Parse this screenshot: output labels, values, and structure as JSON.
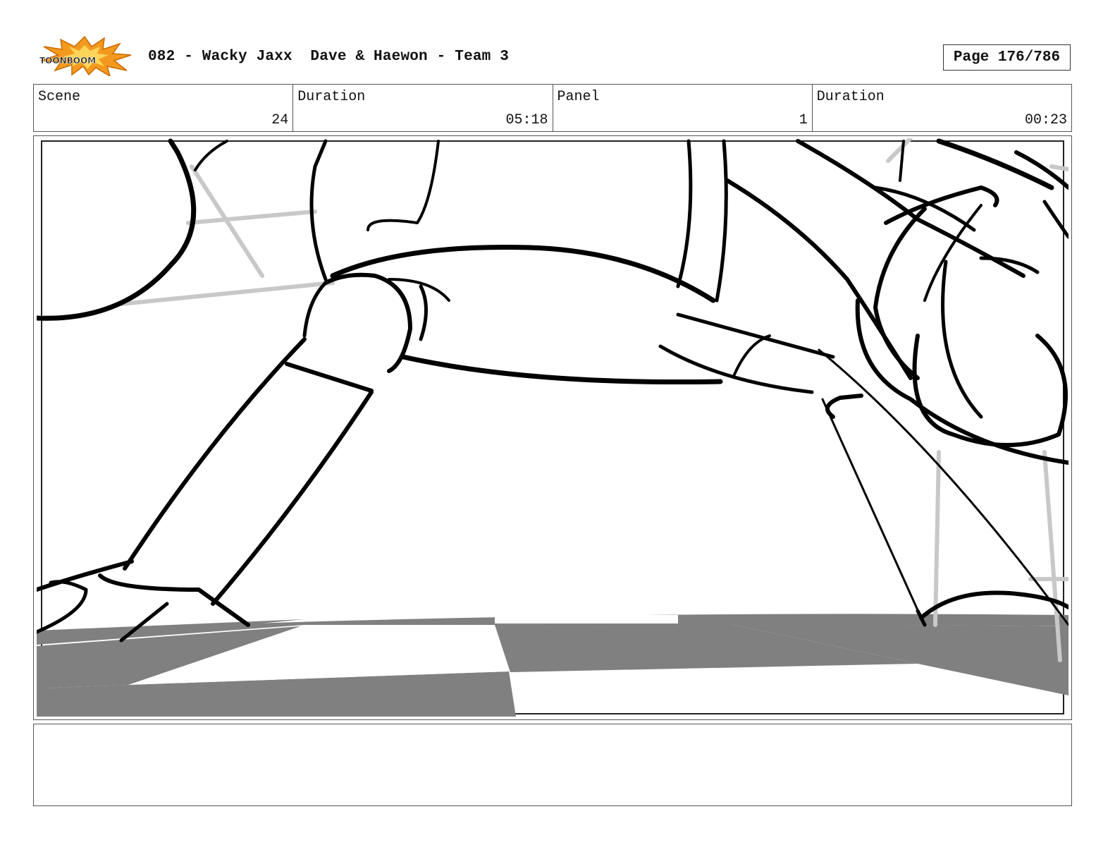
{
  "header": {
    "logo_text": "TOONBOOM",
    "title": "082 - Wacky Jaxx  Dave & Haewon - Team 3",
    "page_label": "Page 176/786"
  },
  "info": {
    "scene_label": "Scene",
    "scene_value": "24",
    "scene_duration_label": "Duration",
    "scene_duration_value": "05:18",
    "panel_label": "Panel",
    "panel_value": "1",
    "panel_duration_label": "Duration",
    "panel_duration_value": "00:23"
  },
  "notes": {
    "text": ""
  },
  "colors": {
    "logo_burst": "#f39a1e",
    "floor_gray": "#808080",
    "guide_gray": "#c8c8c8",
    "ink": "#000000"
  }
}
